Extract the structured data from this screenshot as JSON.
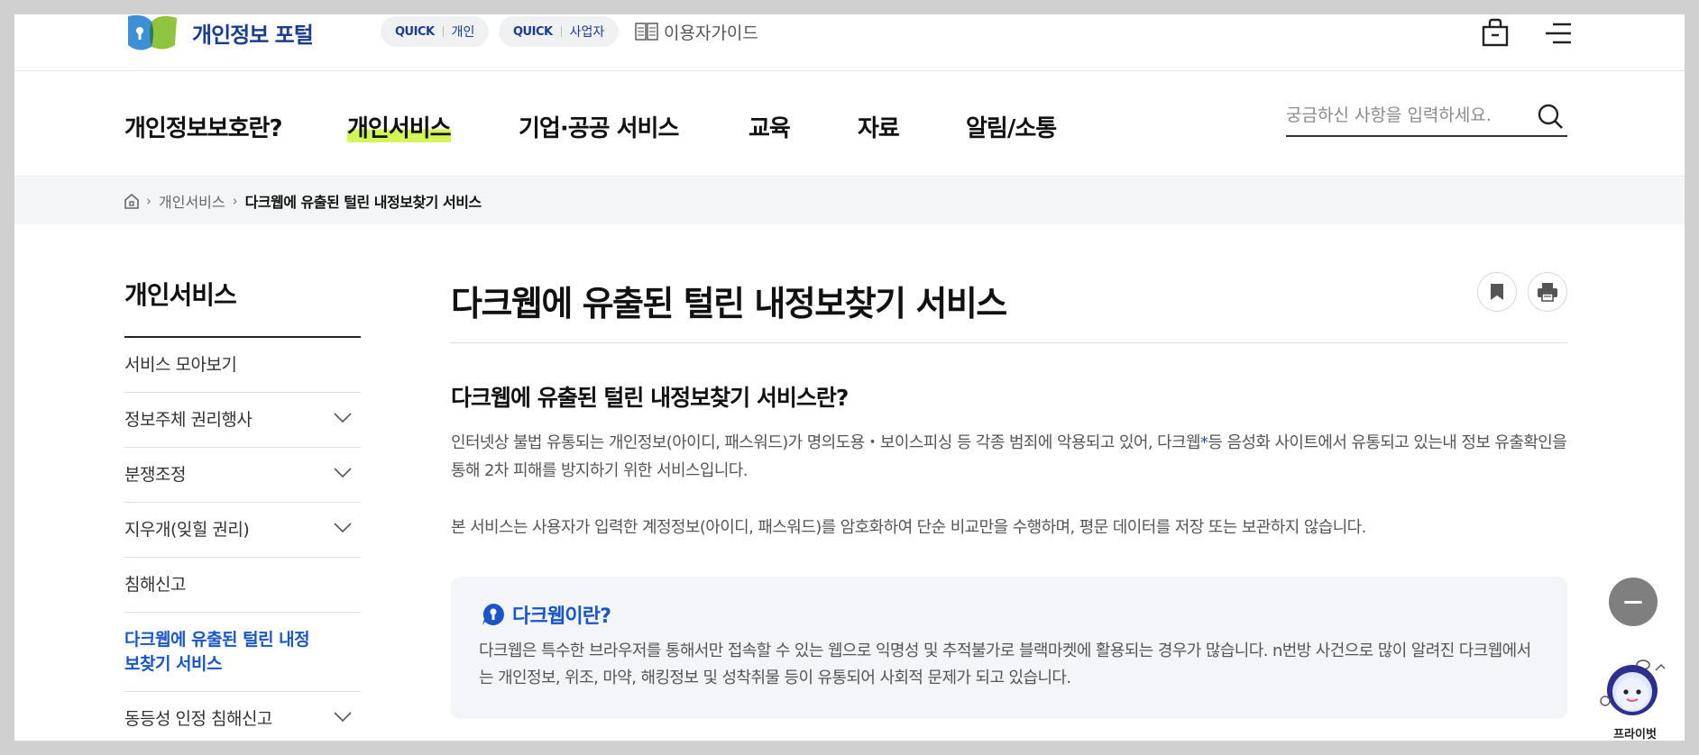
{
  "header": {
    "logo_text": "개인정보 포털",
    "quick_links": [
      {
        "label": "QUICK",
        "target": "개인"
      },
      {
        "label": "QUICK",
        "target": "사업자"
      }
    ],
    "guide_label": "이용자가이드"
  },
  "gnb": {
    "items": [
      {
        "label": "개인정보보호란?",
        "active": false
      },
      {
        "label": "개인서비스",
        "active": true
      },
      {
        "label": "기업·공공 서비스",
        "active": false
      },
      {
        "label": "교육",
        "active": false
      },
      {
        "label": "자료",
        "active": false
      },
      {
        "label": "알림/소통",
        "active": false
      }
    ],
    "search_placeholder": "궁금하신 사항을 입력하세요."
  },
  "breadcrumb": {
    "items": [
      "개인서비스",
      "다크웹에 유출된 털린 내정보찾기 서비스"
    ]
  },
  "sidebar": {
    "title": "개인서비스",
    "items": [
      {
        "label": "서비스 모아보기",
        "expandable": false,
        "active": false
      },
      {
        "label": "정보주체 권리행사",
        "expandable": true,
        "active": false
      },
      {
        "label": "분쟁조정",
        "expandable": true,
        "active": false
      },
      {
        "label": "지우개(잊힐 권리)",
        "expandable": true,
        "active": false
      },
      {
        "label": "침해신고",
        "expandable": false,
        "active": false
      },
      {
        "label": "다크웹에 유출된 털린 내정보찾기 서비스",
        "expandable": false,
        "active": true
      },
      {
        "label": "동등성 인정 침해신고",
        "expandable": true,
        "active": false
      }
    ]
  },
  "content": {
    "title": "다크웹에 유출된 털린 내정보찾기 서비스",
    "section_title": "다크웹에 유출된 털린 내정보찾기 서비스란?",
    "para1_a": "인터넷상 불법 유통되는 개인정보(아이디, 패스워드)가 명의도용・보이스피싱 등 각종 범죄에 악용되고 있어, 다크웹",
    "para1_star": "*",
    "para1_b": "등 음성화 사이트에서 유통되고 있는내 정보 유출확인을 통해 2차 피해를 방지하기 위한 서비스입니다.",
    "para2": "본 서비스는 사용자가 입력한 계정정보(아이디, 패스워드)를 암호화하여 단순 비교만을 수행하며, 평문 데이터를 저장 또는 보관하지 않습니다.",
    "info_title": "다크웹이란?",
    "info_text": "다크웹은 특수한 브라우저를 통해서만 접속할 수 있는 웹으로 익명성 및 추적불가로 블랙마켓에 활용되는 경우가 많습니다. n번방 사건으로 많이 알려진 다크웹에서는 개인정보, 위조, 마약, 해킹정보 및 성착취물 등이 유통되어 사회적 문제가 되고 있습니다."
  },
  "chatbot": {
    "label": "프라이벗"
  },
  "colors": {
    "brand_blue": "#1a3d8f",
    "link_blue": "#1a55c9",
    "highlight": "#d2f65a"
  },
  "icons": [
    "logo-icon",
    "bag-icon",
    "menu-icon",
    "search-icon",
    "home-icon",
    "chevron-down-icon",
    "bookmark-icon",
    "print-icon",
    "info-icon",
    "minus-icon",
    "chatbot-icon",
    "book-icon"
  ]
}
